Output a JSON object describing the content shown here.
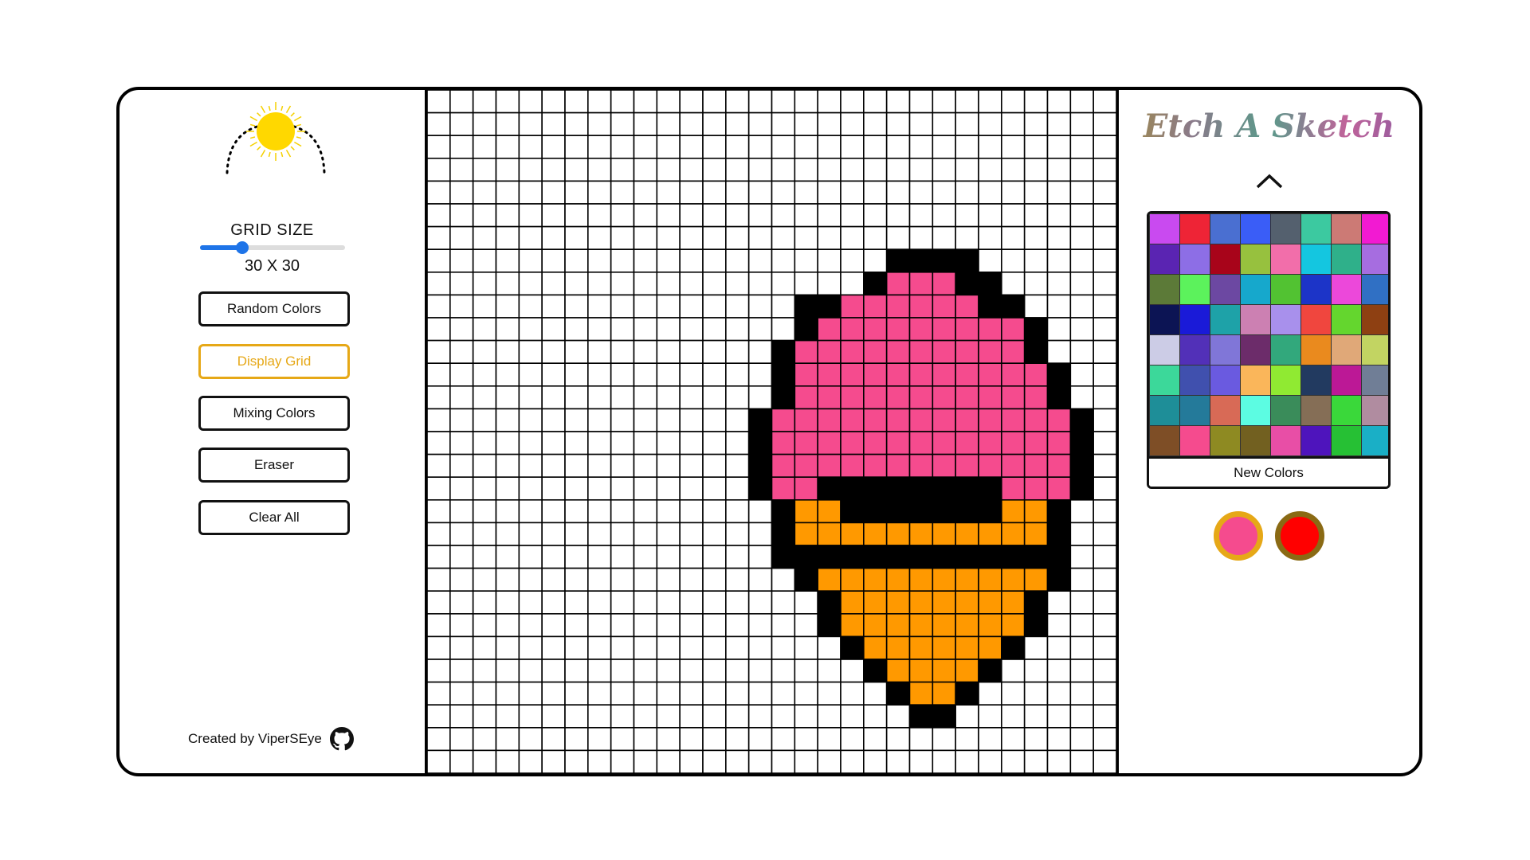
{
  "controls": {
    "grid_size_label": "GRID SIZE",
    "grid_size_value": "30 X 30",
    "grid_size_slider": {
      "min": 1,
      "max": 100,
      "value": 30
    },
    "buttons": [
      {
        "label": "Random Colors",
        "active": false
      },
      {
        "label": "Display Grid",
        "active": true
      },
      {
        "label": "Mixing Colors",
        "active": false
      },
      {
        "label": "Eraser",
        "active": false
      },
      {
        "label": "Clear All",
        "active": false
      }
    ]
  },
  "footer": {
    "credit": "Created by ViperSEye",
    "icon": "github-icon"
  },
  "theme_toggle": {
    "icon": "sun-icon"
  },
  "sidebar_right": {
    "title": "Etch A Sketch",
    "collapse_icon": "chevron-up-icon",
    "new_colors_label": "New Colors"
  },
  "palette": [
    "#c94af0",
    "#ee2436",
    "#4a6fd1",
    "#3a5df7",
    "#54606e",
    "#3cc9a0",
    "#cc7a75",
    "#f21ad2",
    "#5a24b2",
    "#8d6ee6",
    "#a8041a",
    "#97c13e",
    "#f26eaa",
    "#14c6e0",
    "#2fb08a",
    "#a66de0",
    "#5c7a38",
    "#5cf25c",
    "#6c48a2",
    "#16a8cc",
    "#52c232",
    "#1c34c8",
    "#ec48da",
    "#3070c4",
    "#0c1454",
    "#1a1ad8",
    "#1ea2a8",
    "#cc80b2",
    "#a890ec",
    "#f0463e",
    "#64d62e",
    "#8e4012",
    "#cccce6",
    "#5230b8",
    "#8076d8",
    "#6c2c6a",
    "#32a87c",
    "#ea8a1e",
    "#e0a878",
    "#c2d462",
    "#3cd89a",
    "#4050ae",
    "#6a5ae0",
    "#fab65a",
    "#90ea32",
    "#223a60",
    "#bc1896",
    "#707e96",
    "#1e8e98",
    "#247a9a",
    "#d86a56",
    "#5cfce2",
    "#3a8c5a",
    "#856e56",
    "#3ad83a",
    "#b08ca0",
    "#7e4e26",
    "#f54b8e",
    "#8e8a22",
    "#726020",
    "#e84ea6",
    "#4e14bc",
    "#26c034",
    "#1aafc6"
  ],
  "current_colors": {
    "primary": "#f54b8e",
    "primary_ring": "#e6a817",
    "secondary": "#ff0000",
    "secondary_ring": "#8a6a14"
  },
  "canvas": {
    "size": 30,
    "cell_colors": {
      "k": "#000000",
      "p": "#f54b8e",
      "o": "#ff9900"
    },
    "rows": [
      "..............................",
      "..............................",
      "..............................",
      "..............................",
      "..............................",
      "..............................",
      "..............................",
      "....................kkkk......",
      "...................kpppkk.....",
      "................kkppppppkk....",
      "................kpppppppppk...",
      "...............kppppppppppk...",
      "...............kpppppppppppk..",
      "...............kpppppppppppk..",
      "..............kpppppppppppppk.",
      "..............kpppppppppppppk.",
      "..............kpppppppppppppk.",
      "..............kppkkkkkkkkpppk.",
      "...............kookkkkkkkook..",
      "...............koooooooooook..",
      "...............kkkkkkkkkkkkk..",
      "................kooooooooook...",
      ".................kooooooook....",
      ".................kooooooook....",
      "..................kooooook.....",
      "...................kooook......",
      "....................kook.......",
      ".....................kk........",
      "..............................",
      ".............................."
    ]
  }
}
